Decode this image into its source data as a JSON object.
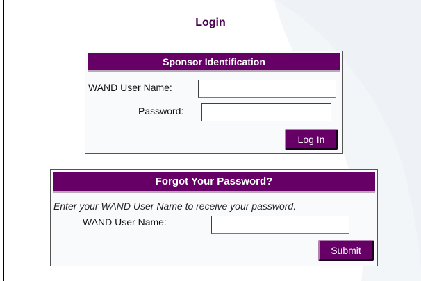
{
  "page": {
    "title": "Login"
  },
  "sponsor_panel": {
    "header": "Sponsor Identification",
    "username_label": "WAND User Name:",
    "username_value": "",
    "password_label": "Password:",
    "password_value": "",
    "login_button": "Log In"
  },
  "forgot_panel": {
    "header": "Forgot Your Password?",
    "instructions": "Enter your WAND User Name to receive your password.",
    "username_label": "WAND User Name:",
    "username_value": "",
    "submit_button": "Submit"
  },
  "colors": {
    "accent": "#660066",
    "title": "#4a0050",
    "background_swoosh": "#eef2f6"
  }
}
